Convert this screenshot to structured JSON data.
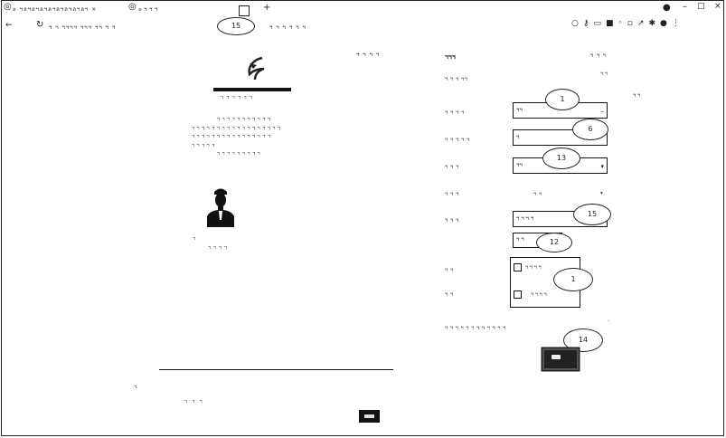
{
  "browser": {
    "tab_title": "๏ ฯลฯลฯลฯลฯลฯลฯลฯลฯ ×",
    "tab2": "๏ ฯ ฯ ฯ",
    "new_tab": "+",
    "url": "ฯ ฯ ฯฯฯฯ ฯฯฯ ฯฯ ฯ ฯ",
    "url_suffix": "ฯ ฯ ฯ ฯ ฯ ฯ",
    "window_controls": [
      "–",
      "□",
      "×"
    ],
    "toolbar_icons": [
      "search-icon",
      "key-icon",
      "screenshot-icon",
      "extension-icon",
      "zoom-icon",
      "bookmark-icon",
      "share-icon",
      "star-icon",
      "profile-icon",
      "menu-icon"
    ]
  },
  "annotations": [
    {
      "id": "b15",
      "label": "15"
    },
    {
      "id": "b1a",
      "label": "1"
    },
    {
      "id": "b6",
      "label": "6"
    },
    {
      "id": "b13",
      "label": "13"
    },
    {
      "id": "b15b",
      "label": "15"
    },
    {
      "id": "b12",
      "label": "12"
    },
    {
      "id": "b1b",
      "label": "1"
    },
    {
      "id": "b14",
      "label": "14"
    }
  ],
  "document": {
    "corner_text": "ฯ ฯ ฯ ฯ",
    "org_name": "ฯฯฯฯฯฯฯฯฯฯฯฯฯฯ",
    "org_sub": "ฯ ฯ ฯ ฯ ฯ ฯ",
    "paragraph": [
      "ฯ ฯ ฯ ฯ ฯ ฯ ฯ ฯ ฯ ฯ ฯ",
      "ฯ ฯ ฯ ฯ ฯ ฯ ฯ ฯ ฯ ฯ ฯ ฯ ฯ ฯ ฯ ฯ ฯ ฯ",
      "ฯ ฯ ฯ ฯ ฯ ฯ ฯ ฯ ฯ ฯ ฯ ฯ ฯ ฯ ฯ ฯ",
      "ฯ ฯ ฯ ฯ ฯ",
      "ฯ ฯ ฯ ฯ ฯ ฯ ฯ ฯ ฯ"
    ],
    "caption1": "ฯ",
    "caption2": "ฯ ฯ ฯ ฯ",
    "footer_a": "ฯ.",
    "footer_b": "ฯ ฯ ฯ"
  },
  "form": {
    "heading": "ฯฯฯ",
    "heading_right": "ฯ ฯ ฯ",
    "row0_label": "ฯ ฯ ฯ ฯฯ",
    "row0_value": "ฯ ฯ",
    "row0_note": "ฯ ฯ",
    "select1_label": "ฯ ฯ ฯ ฯ",
    "select1_value": "ฯฯ",
    "input_label": "ฯ ฯ ฯ ฯ ฯ",
    "input_value": "ฯ",
    "select2_label": "ฯ ฯ ฯ",
    "select2_value": "ฯฯ",
    "plain_label": "ฯ ฯ ฯ",
    "plain_value": "ฯ ฯ",
    "select3_label": "ฯ ฯ ฯ",
    "select3_value": "ฯ ฯ ฯ ฯ",
    "small_value": "ฯ ฯ",
    "check_group_label": "ฯ ฯ",
    "check1_label": "ฯ ฯ ฯ ฯ",
    "check_group2_label": "ฯ ฯ",
    "check2_label": "ฯ ฯ ฯ ฯ",
    "consent_text": "ฯ ฯ ฯ ฯ ฯ ฯ ฯ ฯ ฯ ฯ ฯ ฯ"
  }
}
